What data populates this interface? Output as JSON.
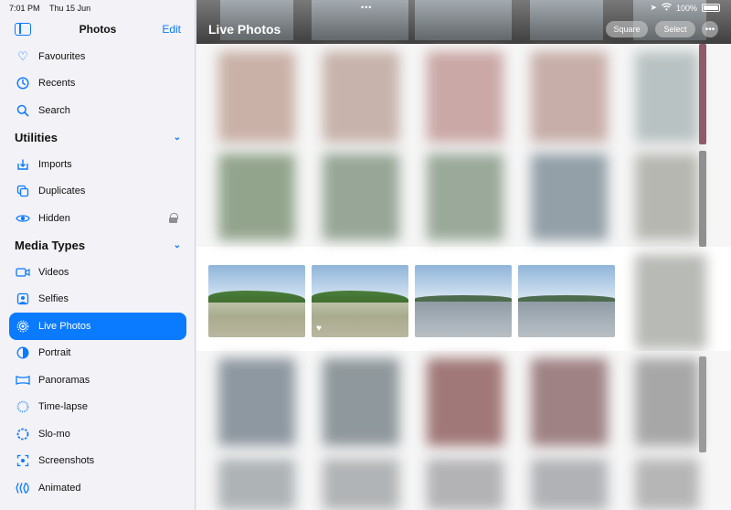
{
  "status": {
    "time": "7:01 PM",
    "date": "Thu 15 Jun",
    "battery": "100%"
  },
  "sidebar": {
    "title": "Photos",
    "edit_label": "Edit",
    "items_top": [
      {
        "label": "Favourites",
        "icon": "heart-icon"
      },
      {
        "label": "Recents",
        "icon": "clock-icon"
      },
      {
        "label": "Search",
        "icon": "search-icon"
      }
    ],
    "utilities": {
      "label": "Utilities",
      "items": [
        {
          "label": "Imports",
          "icon": "import-icon"
        },
        {
          "label": "Duplicates",
          "icon": "duplicates-icon"
        },
        {
          "label": "Hidden",
          "icon": "eye-icon"
        }
      ]
    },
    "media_types": {
      "label": "Media Types",
      "items": [
        {
          "label": "Videos",
          "icon": "video-icon"
        },
        {
          "label": "Selfies",
          "icon": "selfie-icon"
        },
        {
          "label": "Live Photos",
          "icon": "live-photo-icon"
        },
        {
          "label": "Portrait",
          "icon": "portrait-icon"
        },
        {
          "label": "Panoramas",
          "icon": "panorama-icon"
        },
        {
          "label": "Time-lapse",
          "icon": "timelapse-icon"
        },
        {
          "label": "Slo-mo",
          "icon": "slomo-icon"
        },
        {
          "label": "Screenshots",
          "icon": "screenshot-icon"
        },
        {
          "label": "Animated",
          "icon": "animated-icon"
        }
      ]
    }
  },
  "main": {
    "title": "Live Photos",
    "square_label": "Square",
    "select_label": "Select",
    "more_label": "•••"
  },
  "colors": {
    "accent": "#0a7aff",
    "sidebar_bg": "#f2f2f7"
  }
}
